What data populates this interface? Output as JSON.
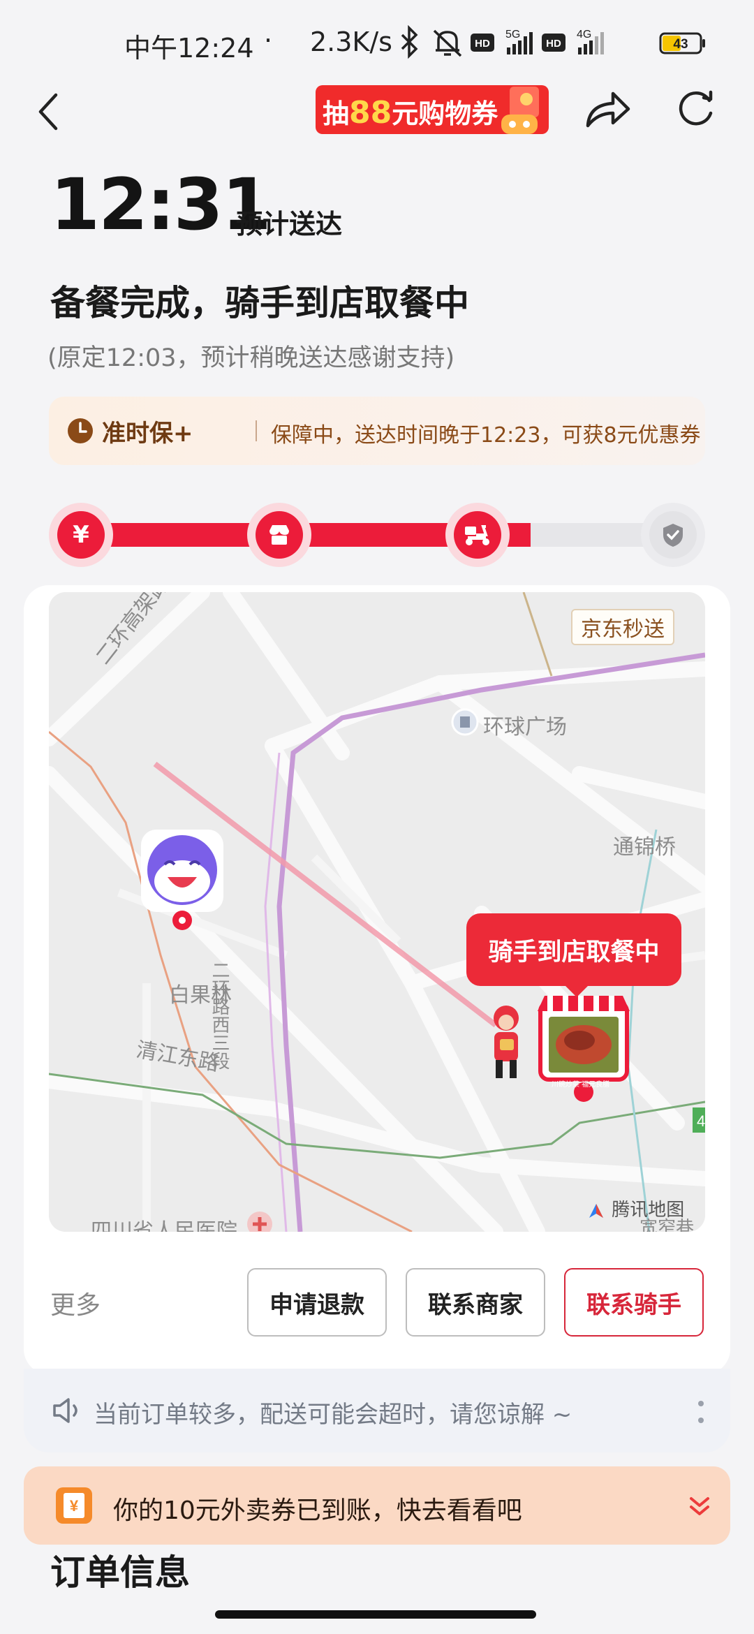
{
  "status_bar": {
    "time": "中午12:24",
    "dot": "·",
    "net_speed": "2.3K/s",
    "hd1": "HD",
    "net1": "5G",
    "hd2": "HD",
    "net2": "4G",
    "battery": "43"
  },
  "nav": {
    "promo_prefix": "抽",
    "promo_number": "88",
    "promo_suffix": "元购物券"
  },
  "eta": {
    "time": "12:31",
    "label": "预计送达"
  },
  "status": {
    "headline": "备餐完成，骑手到店取餐中",
    "subline": "(原定12:03，预计稍晚送达感谢支持)"
  },
  "guarantee": {
    "title": "准时保+",
    "text": "保障中，送达时间晚于12:23，可获8元优惠券"
  },
  "progress": {
    "steps": [
      "paid",
      "store",
      "delivery",
      "delivered"
    ],
    "current_step": 3,
    "yuan_symbol": "¥"
  },
  "map": {
    "brand_tag": "京东秒送",
    "rider_status": "骑手到店取餐中",
    "provider": "腾讯地图",
    "labels": {
      "road_ring_elevated": "二环高架路",
      "global_plaza": "环球广场",
      "tongjin_bridge": "通锦桥",
      "baiguolin": "白果林",
      "ring_road_west": "二环路西三段",
      "qingjiang_road": "清江东路",
      "hospital": "四川省人民医院",
      "kuanzhai": "宽窄巷"
    },
    "store_sign": "川碗炒菜 福元良膳"
  },
  "actions": {
    "more": "更多",
    "refund": "申请退款",
    "contact_merchant": "联系商家",
    "contact_rider": "联系骑手"
  },
  "notice": {
    "text": "当前订单较多，配送可能会超时，请您谅解 ~"
  },
  "coupon": {
    "text": "你的10元外卖券已到账，快去看看吧"
  },
  "order_info": {
    "title": "订单信息"
  },
  "colors": {
    "accent_red": "#ec1c3a",
    "guarantee_brown": "#6e3a12",
    "coupon_bg": "#fbd9c4"
  }
}
